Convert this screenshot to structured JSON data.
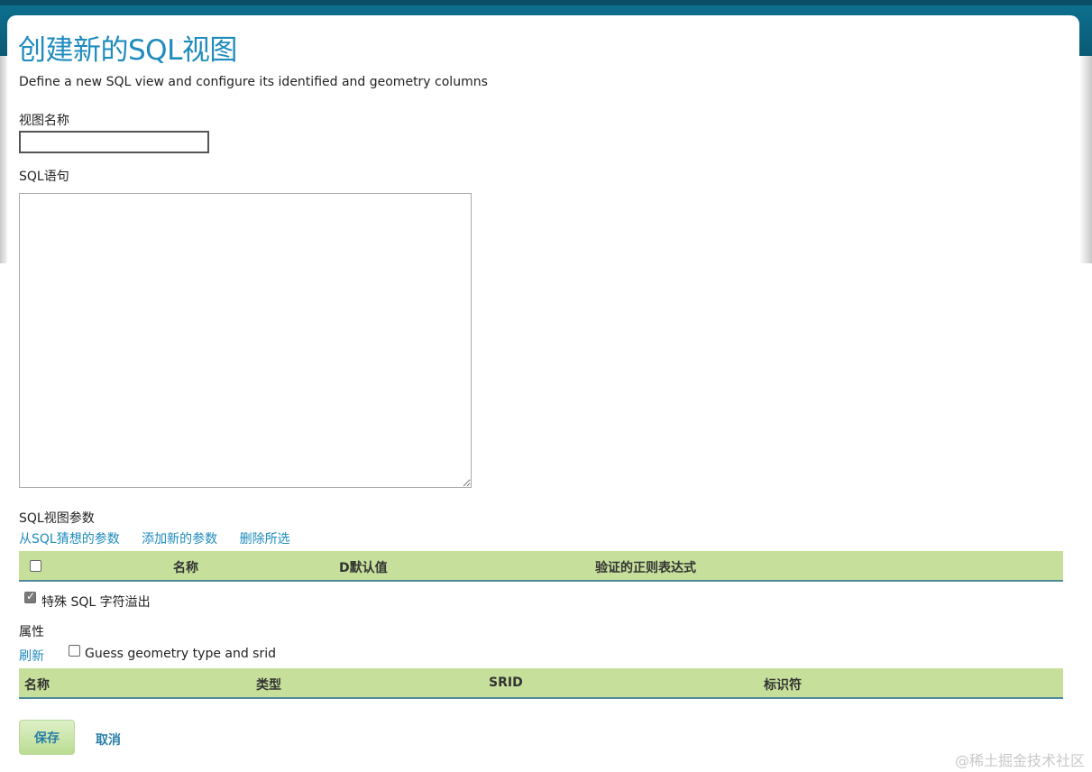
{
  "page": {
    "title": "创建新的SQL视图",
    "description": "Define a new SQL view and configure its identified and geometry columns"
  },
  "view_name": {
    "label": "视图名称",
    "value": ""
  },
  "sql": {
    "label": "SQL语句",
    "value": ""
  },
  "params": {
    "label": "SQL视图参数",
    "links": {
      "guess": "从SQL猜想的参数",
      "add": "添加新的参数",
      "delete": "删除所选"
    },
    "columns": {
      "name": "名称",
      "default": "D默认值",
      "validation": "验证的正则表达式"
    },
    "escape_label": "特殊 SQL 字符溢出",
    "escape_checked": true
  },
  "attributes": {
    "label": "属性",
    "refresh": "刷新",
    "guess_label": "Guess geometry type and srid",
    "guess_checked": false,
    "columns": {
      "name": "名称",
      "type": "类型",
      "srid": "SRID",
      "identifier": "标识符"
    }
  },
  "actions": {
    "save": "保存",
    "cancel": "取消"
  },
  "watermark": "@稀土掘金技术社区",
  "colors": {
    "accent": "#1f8bbd",
    "header_band": "#0d6f8e",
    "grid_header": "#c6e09b"
  }
}
